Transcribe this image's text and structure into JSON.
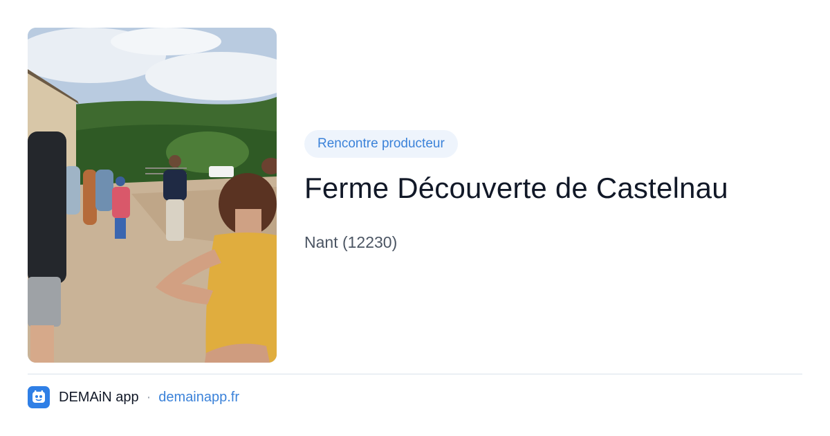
{
  "card": {
    "category": "Rencontre producteur",
    "title": "Ferme Découverte de Castelnau",
    "location": "Nant (12230)"
  },
  "photo": {
    "alt_name": "farm-visit-photo"
  },
  "footer": {
    "app_name": "DEMAiN app",
    "separator": "·",
    "site": "demainapp.fr",
    "icon": "demain-app-icon"
  },
  "colors": {
    "accent": "#3b82d9",
    "tag_background": "#eef4fc",
    "title": "#111827",
    "muted": "#4b5563",
    "divider": "#d9e2ea",
    "app_icon": "#2f7fe6"
  }
}
